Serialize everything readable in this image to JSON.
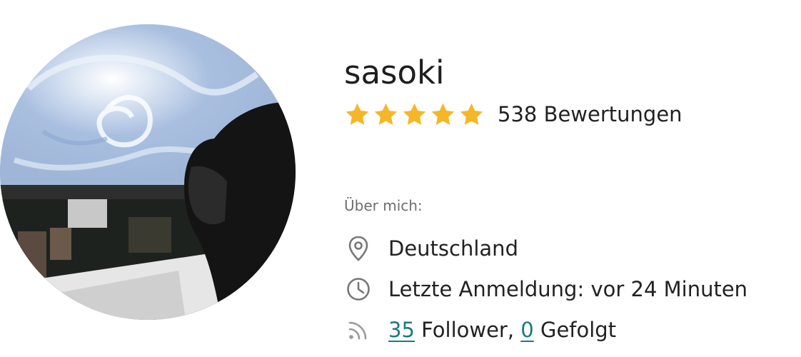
{
  "profile": {
    "username": "sasoki",
    "rating": {
      "stars": 5,
      "max_stars": 5,
      "count_label": "538 Bewertungen"
    },
    "about_label": "Über mich:",
    "location": "Deutschland",
    "last_login": "Letzte Anmeldung: vor 24 Minuten",
    "followers_count": "35",
    "followers_label": "Follower,",
    "following_count": "0",
    "following_label": "Gefolgt"
  },
  "icons": {
    "star": "star-icon",
    "location": "location-pin-icon",
    "clock": "clock-icon",
    "follow": "rss-icon"
  },
  "colors": {
    "star": "#f5b728",
    "link": "#1a7a80",
    "muted": "#6e6e6e",
    "text": "#222222"
  }
}
